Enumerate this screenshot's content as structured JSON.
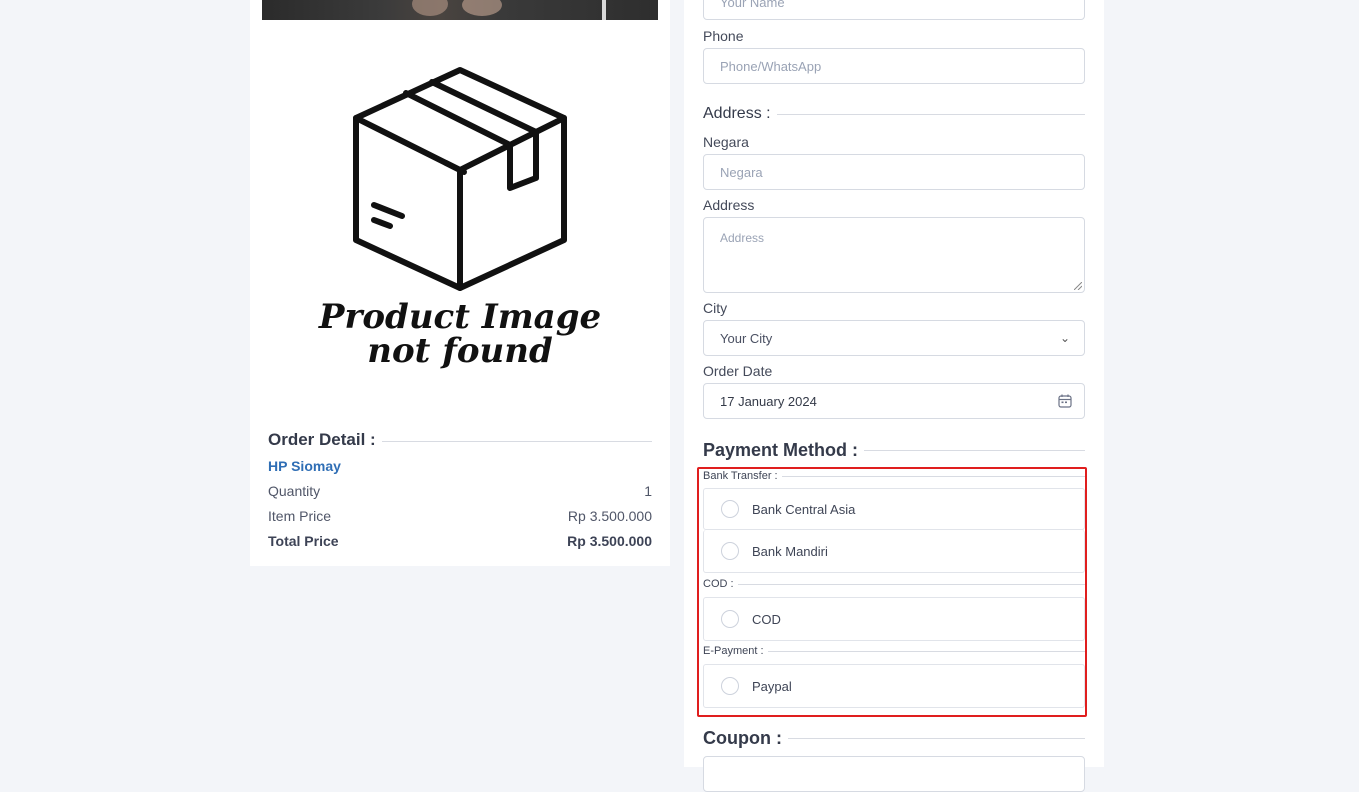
{
  "product_image": {
    "placeholder_line1": "Product Image",
    "placeholder_line2": "not found",
    "icon": "box-icon"
  },
  "order_detail": {
    "heading": "Order Detail :",
    "product_name": "HP Siomay",
    "quantity_label": "Quantity",
    "quantity_value": "1",
    "item_price_label": "Item Price",
    "item_price_value": "Rp 3.500.000",
    "total_price_label": "Total Price",
    "total_price_value": "Rp 3.500.000"
  },
  "form": {
    "name_placeholder": "Your Name",
    "phone_label": "Phone",
    "phone_placeholder": "Phone/WhatsApp",
    "address_heading": "Address :",
    "negara_label": "Negara",
    "negara_placeholder": "Negara",
    "address_label": "Address",
    "address_placeholder": "Address",
    "city_label": "City",
    "city_value": "Your City",
    "order_date_label": "Order Date",
    "order_date_value": "17 January 2024",
    "payment_heading": "Payment Method :",
    "coupon_heading": "Coupon :"
  },
  "payment": {
    "groups": [
      {
        "label": "Bank Transfer :",
        "options": [
          "Bank Central Asia",
          "Bank Mandiri"
        ]
      },
      {
        "label": "COD :",
        "options": [
          "COD"
        ]
      },
      {
        "label": "E-Payment :",
        "options": [
          "Paypal"
        ]
      }
    ],
    "highlight_color": "#e01e1e"
  },
  "colors": {
    "product_link": "#2f6eb5",
    "background": "#f3f5f9"
  }
}
